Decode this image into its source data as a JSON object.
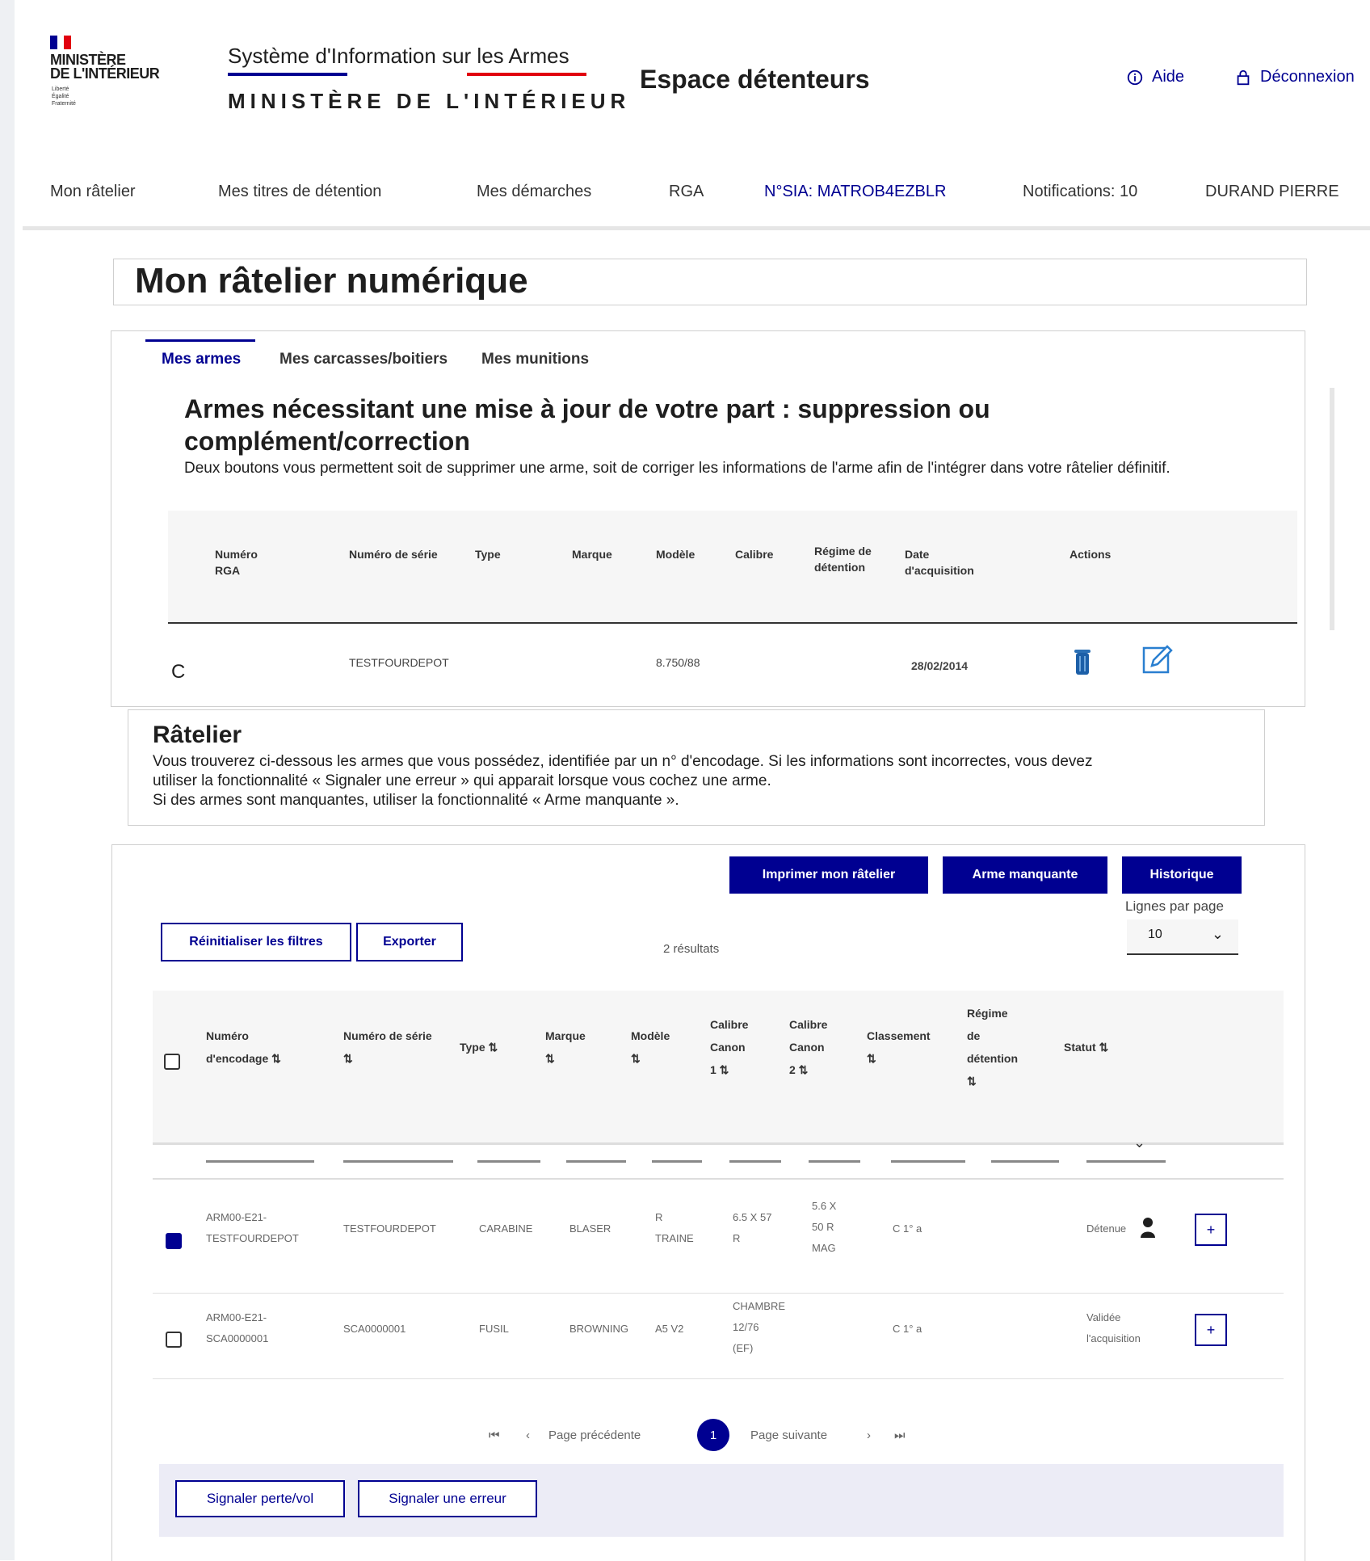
{
  "header": {
    "ministry_line1": "MINISTÈRE",
    "ministry_line2": "DE L'INTÉRIEUR",
    "motto_1": "Liberté",
    "motto_2": "Égalité",
    "motto_3": "Fraternité",
    "sia_title": "Système d'Information sur les Armes",
    "sia_subtitle": "MINISTÈRE DE L'INTÉRIEUR",
    "space_title": "Espace détenteurs",
    "help_label": "Aide",
    "logout_label": "Déconnexion"
  },
  "nav": {
    "items": [
      "Mon râtelier",
      "Mes titres de détention",
      "Mes démarches",
      "RGA",
      "N°SIA: MATROB4EZBLR",
      "Notifications: 10",
      "DURAND PIERRE"
    ]
  },
  "page_title": "Mon râtelier numérique",
  "tabs": [
    "Mes armes",
    "Mes carcasses/boitiers",
    "Mes munitions"
  ],
  "update_section": {
    "heading": "Armes nécessitant une mise à jour de votre part : suppression ou complément/correction",
    "description": "Deux boutons vous permettent soit de supprimer une arme, soit de corriger les informations de l'arme afin de l'intégrer dans votre râtelier définitif.",
    "columns": {
      "rga": "Numéro RGA",
      "serial": "Numéro de série",
      "type": "Type",
      "brand": "Marque",
      "model": "Modèle",
      "caliber": "Calibre",
      "regime": "Régime de détention",
      "date": "Date d'acquisition",
      "actions": "Actions"
    },
    "row": {
      "rga": "C",
      "serial": "TESTFOURDEPOT",
      "model": "8.750/88",
      "date": "28/02/2014"
    }
  },
  "ratelier": {
    "heading": "Râtelier",
    "line1": "Vous trouverez ci-dessous les armes que vous possédez, identifiée par un n° d'encodage. Si les informations sont incorrectes, vous devez",
    "line2": "utiliser la fonctionnalité « Signaler une erreur » qui apparait lorsque vous cochez une arme.",
    "line3": "Si des armes sont manquantes, utiliser la fonctionnalité « Arme manquante »."
  },
  "table": {
    "btn_print": "Imprimer mon râtelier",
    "btn_missing": "Arme manquante",
    "btn_history": "Historique",
    "lines_per_page_label": "Lignes par page",
    "lines_per_page_value": "10",
    "btn_reset": "Réinitialiser les filtres",
    "btn_export": "Exporter",
    "results": "2 résultats",
    "columns": {
      "encoding": [
        "Numéro",
        "d'encodage ⇅"
      ],
      "serial": [
        "Numéro de série",
        "⇅"
      ],
      "type": [
        "Type ⇅"
      ],
      "brand": [
        "Marque",
        "⇅"
      ],
      "model": [
        "Modèle",
        "⇅"
      ],
      "cal1": [
        "Calibre",
        "Canon",
        "1 ⇅"
      ],
      "cal2": [
        "Calibre",
        "Canon",
        "2 ⇅"
      ],
      "class": [
        "Classement",
        "⇅"
      ],
      "regime": [
        "Régime",
        "de",
        "détention",
        "⇅"
      ],
      "status": [
        "Statut ⇅"
      ]
    },
    "rows": [
      {
        "checked": true,
        "encoding": [
          "ARM00-E21-",
          "TESTFOURDEPOT"
        ],
        "serial": [
          "TESTFOURDEPOT"
        ],
        "type": [
          "CARABINE"
        ],
        "brand": [
          "BLASER"
        ],
        "model": [
          "R",
          "TRAINE"
        ],
        "cal1": [
          "6.5 X 57",
          "R"
        ],
        "cal2": [
          "5.6 X",
          "50 R",
          "MAG"
        ],
        "class": [
          "C 1° a"
        ],
        "status": "Détenue"
      },
      {
        "checked": false,
        "encoding": [
          "ARM00-E21-",
          "SCA0000001"
        ],
        "serial": [
          "SCA0000001"
        ],
        "type": [
          "FUSIL"
        ],
        "brand": [
          "BROWNING"
        ],
        "model": [
          "A5 V2"
        ],
        "cal1": [
          "CHAMBRE",
          "12/76",
          "(EF)"
        ],
        "cal2": [],
        "class": [
          "C 1° a"
        ],
        "status_lines": [
          "Validée",
          "l'acquisition"
        ]
      }
    ],
    "pagination": {
      "first": "⏮",
      "prev": "‹",
      "prev_label": "Page précédente",
      "current": "1",
      "next_label": "Page suivante",
      "next": "›",
      "last": "⏭"
    },
    "btn_report_loss": "Signaler perte/vol",
    "btn_report_error": "Signaler une erreur"
  },
  "colors": {
    "primary": "#000091",
    "marianne_red": "#e1000f",
    "border": "#cfcfcf"
  }
}
